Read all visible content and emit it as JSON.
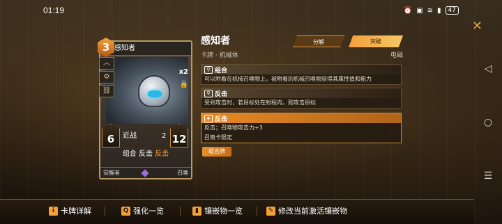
{
  "status": {
    "time": "01:19",
    "battery": "47"
  },
  "card": {
    "cost": "3",
    "name": "感知者",
    "multiplier": "x2",
    "attack": "6",
    "range": "近战",
    "mid_value": "2",
    "health": "12",
    "keywords": {
      "part1": "组合",
      "part2": "反击",
      "part3": "反击"
    },
    "faction": "觉醒者",
    "type_label": "召唤"
  },
  "detail": {
    "title": "感知者",
    "subtitle": "卡牌 · 机械体",
    "element": "电磁",
    "dismantle_label": "分解",
    "breakthrough_label": "突破",
    "abilities": [
      {
        "name": "组合",
        "desc": "可以附着在机械召唤物上，被附着的机械召唤物获得其属性值和能力"
      },
      {
        "name": "反击",
        "desc": "受到攻击时，若目标处在射程内，则攻击目标"
      },
      {
        "name": "反击",
        "desc": "反击；召唤物攻击力+3",
        "desc2": "召唤卡限定"
      }
    ],
    "tag": "组合牌"
  },
  "bottom_bar": {
    "card_details": "卡牌详解",
    "enhance_list": "强化一览",
    "inlay_list": "镶嵌物一览",
    "modify_inlay": "修改当前激活镶嵌物"
  }
}
